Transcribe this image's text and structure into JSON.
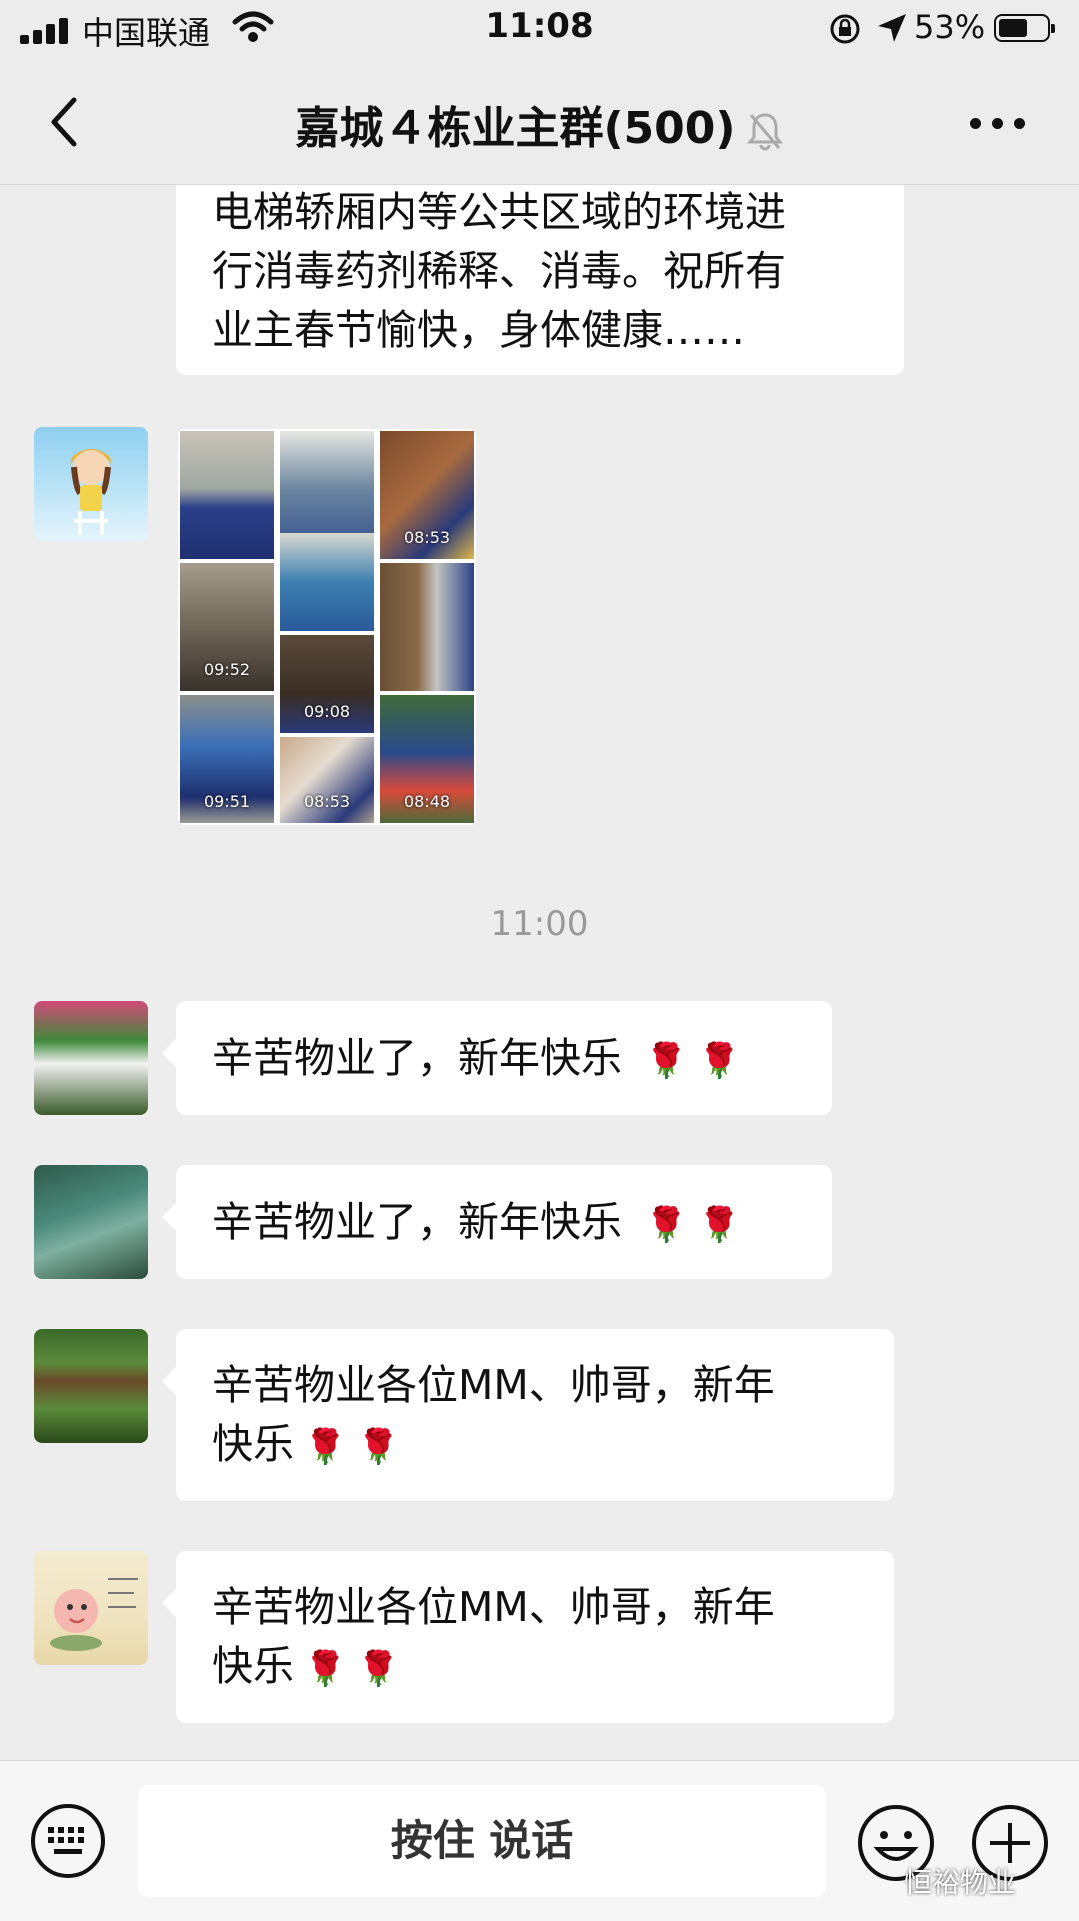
{
  "status_bar": {
    "carrier": "中国联通",
    "time": "11:08",
    "battery": "53%"
  },
  "nav": {
    "title": "嘉城４栋业主群(500)"
  },
  "messages": {
    "m0_lines": [
      "电梯轿厢内等公共区域的环境进",
      "行消毒药剂稀释、消毒。祝所有",
      "业主春节愉快，身体健康……"
    ],
    "image_times": [
      "08:53",
      "09:52",
      "09:08",
      "09:51",
      "08:53",
      "08:48"
    ],
    "timestamp": "11:00",
    "m1": "辛苦物业了，新年快乐",
    "m2": "辛苦物业了，新年快乐",
    "m3_lines": [
      "辛苦物业各位MM、帅哥，新年",
      "快乐"
    ],
    "m4_lines": [
      "辛苦物业各位MM、帅哥，新年",
      "快乐"
    ],
    "rose": "🌹 🌹"
  },
  "input_bar": {
    "hold_to_talk": "按住 说话",
    "watermark": "恒裕物业"
  },
  "colors": {
    "background": "#ededed",
    "bubble": "#ffffff",
    "timestamp": "#999999"
  }
}
